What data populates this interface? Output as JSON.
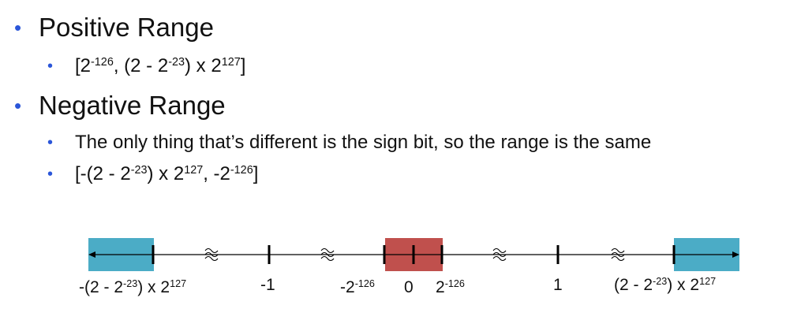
{
  "bullets": [
    {
      "level": 1,
      "text": "Positive Range"
    },
    {
      "level": 2,
      "parts": [
        "[2",
        "-126",
        ", (2 - 2",
        "-23",
        ") x 2",
        "127",
        "]"
      ]
    },
    {
      "level": 1,
      "text": "Negative Range"
    },
    {
      "level": 2,
      "text": "The only thing that’s different is the sign bit, so the range is the same"
    },
    {
      "level": 2,
      "parts": [
        "[-(2 - 2",
        "-23",
        ") x 2",
        "127",
        ", -2",
        "-126",
        "]"
      ]
    }
  ],
  "number_line": {
    "labels": {
      "neg_max": {
        "parts": [
          "-(2 - 2",
          "-23",
          ") x 2",
          "127"
        ]
      },
      "neg_one": "-1",
      "neg_min": {
        "parts": [
          "-2",
          "-126"
        ]
      },
      "zero": "0",
      "pos_min": {
        "parts": [
          "2",
          "-126"
        ]
      },
      "one": "1",
      "pos_max": {
        "parts": [
          "(2 - 2",
          "-23",
          ") x 2",
          "127"
        ]
      }
    },
    "colors": {
      "representable": "#4bacc6",
      "underflow": "#c0504d",
      "axis": "#000000"
    }
  }
}
